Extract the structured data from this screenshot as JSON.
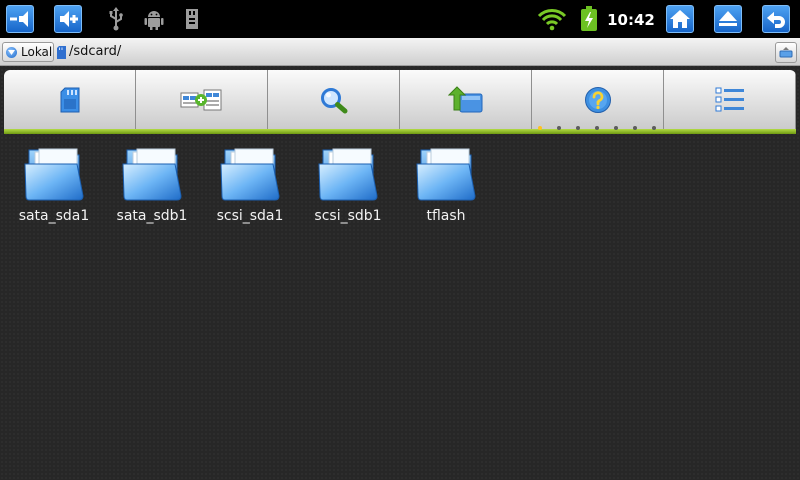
{
  "status_bar": {
    "left_buttons": [
      {
        "icon": "volume-down-icon"
      },
      {
        "icon": "volume-up-icon"
      }
    ],
    "notification_icons": [
      "usb-icon",
      "android-debug-icon",
      "sd-card-icon"
    ],
    "wifi_icon": "wifi-signal-icon",
    "battery_icon": "battery-charging-icon",
    "time": "10:42",
    "right_buttons": [
      {
        "icon": "home-icon"
      },
      {
        "icon": "eject-icon"
      },
      {
        "icon": "back-icon"
      }
    ],
    "colors": {
      "button_top": "#4ea2f2",
      "button_bottom": "#1765c9"
    }
  },
  "path_bar": {
    "location_label": "Lokal",
    "path": "/sdcard/"
  },
  "toolbar": {
    "buttons": [
      {
        "icon": "sd-card-icon"
      },
      {
        "icon": "multi-select-icon"
      },
      {
        "icon": "search-icon"
      },
      {
        "icon": "parent-folder-icon"
      },
      {
        "icon": "help-icon"
      },
      {
        "icon": "list-view-icon"
      }
    ],
    "pager": {
      "total": 7,
      "active": 0
    },
    "accent_color": "#8bb81f"
  },
  "files": [
    {
      "name": "sata_sda1",
      "type": "folder"
    },
    {
      "name": "sata_sdb1",
      "type": "folder"
    },
    {
      "name": "scsi_sda1",
      "type": "folder"
    },
    {
      "name": "scsi_sdb1",
      "type": "folder"
    },
    {
      "name": "tflash",
      "type": "folder"
    }
  ]
}
